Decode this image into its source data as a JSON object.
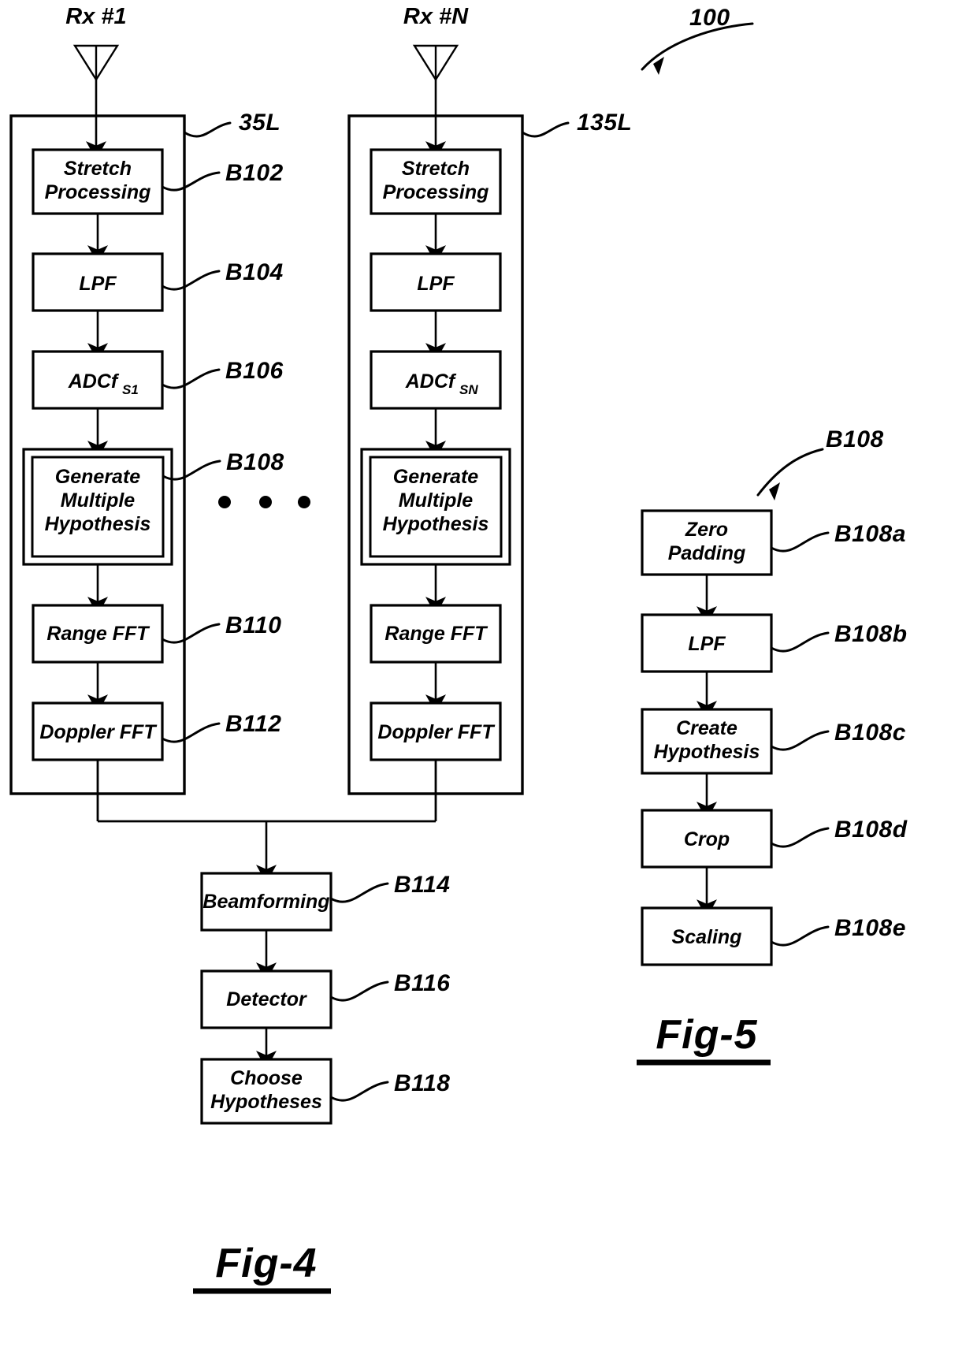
{
  "figure": {
    "page_reference": "100",
    "figures": [
      {
        "id": "fig4",
        "label": "Fig-4"
      },
      {
        "id": "fig5",
        "label": "Fig-5"
      }
    ]
  },
  "fig4": {
    "title": "Fig-4",
    "system_ref": "100",
    "channels": [
      {
        "antenna_label": "Rx #1",
        "channel_ref": "35L",
        "blocks": [
          {
            "label": "Stretch Processing",
            "ref": "B102",
            "lines": [
              "Stretch",
              "Processing"
            ],
            "double": false
          },
          {
            "label": "LPF",
            "ref": "B104",
            "lines": [
              "LPF"
            ],
            "double": false
          },
          {
            "label": "ADCfS1",
            "ref": "B106",
            "lines": [
              "ADCf"
            ],
            "subscript": "S1",
            "double": false
          },
          {
            "label": "Generate Multiple Hypothesis",
            "ref": "B108",
            "lines": [
              "Generate",
              "Multiple",
              "Hypothesis"
            ],
            "double": true
          },
          {
            "label": "Range FFT",
            "ref": "B110",
            "lines": [
              "Range FFT"
            ],
            "double": false
          },
          {
            "label": "Doppler FFT",
            "ref": "B112",
            "lines": [
              "Doppler FFT"
            ],
            "double": false
          }
        ]
      },
      {
        "antenna_label": "Rx #N",
        "channel_ref": "135L",
        "blocks": [
          {
            "label": "Stretch Processing",
            "ref": "",
            "lines": [
              "Stretch",
              "Processing"
            ],
            "double": false
          },
          {
            "label": "LPF",
            "ref": "",
            "lines": [
              "LPF"
            ],
            "double": false
          },
          {
            "label": "ADCfSN",
            "ref": "",
            "lines": [
              "ADCf"
            ],
            "subscript": "SN",
            "double": false
          },
          {
            "label": "Generate Multiple Hypothesis",
            "ref": "",
            "lines": [
              "Generate",
              "Multiple",
              "Hypothesis"
            ],
            "double": true
          },
          {
            "label": "Range FFT",
            "ref": "",
            "lines": [
              "Range FFT"
            ],
            "double": false
          },
          {
            "label": "Doppler FFT",
            "ref": "",
            "lines": [
              "Doppler FFT"
            ],
            "double": false
          }
        ]
      }
    ],
    "ellipsis_dots": 3,
    "common_blocks": [
      {
        "label": "Beamforming",
        "ref": "B114",
        "lines": [
          "Beamforming"
        ]
      },
      {
        "label": "Detector",
        "ref": "B116",
        "lines": [
          "Detector"
        ]
      },
      {
        "label": "Choose Hypotheses",
        "ref": "B118",
        "lines": [
          "Choose",
          "Hypotheses"
        ]
      }
    ]
  },
  "fig5": {
    "title": "Fig-5",
    "detail_ref": "B108",
    "blocks": [
      {
        "label": "Zero Padding",
        "ref": "B108a",
        "lines": [
          "Zero",
          "Padding"
        ]
      },
      {
        "label": "LPF",
        "ref": "B108b",
        "lines": [
          "LPF"
        ]
      },
      {
        "label": "Create Hypothesis",
        "ref": "B108c",
        "lines": [
          "Create",
          "Hypothesis"
        ]
      },
      {
        "label": "Crop",
        "ref": "B108d",
        "lines": [
          "Crop"
        ]
      },
      {
        "label": "Scaling",
        "ref": "B108e",
        "lines": [
          "Scaling"
        ]
      }
    ]
  }
}
